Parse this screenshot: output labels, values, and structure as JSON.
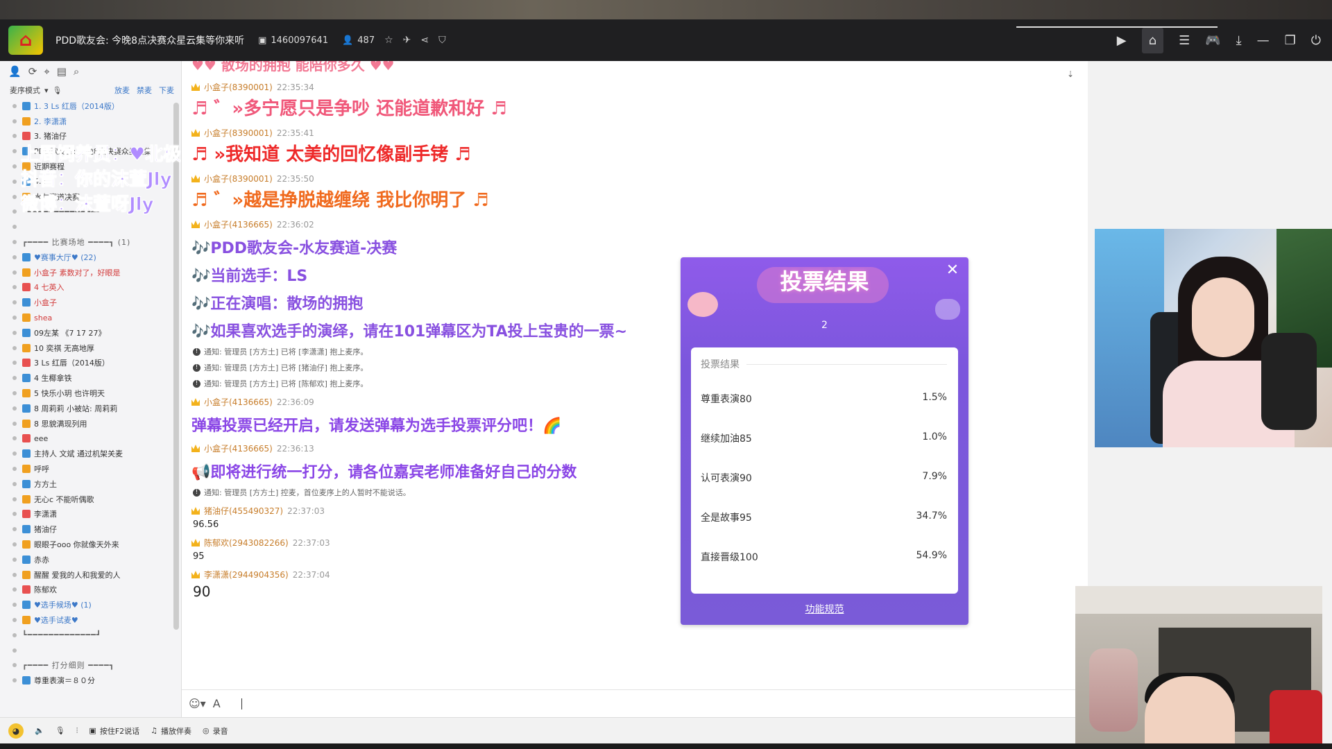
{
  "titlebar": {
    "room_title": "PDD歌友会: 今晚8点决赛众星云集等你来听",
    "room_id": "1460097641",
    "viewers": "487"
  },
  "left": {
    "mode_label": "麦序模式",
    "links": [
      "放麦",
      "禁麦",
      "下麦"
    ],
    "tree": [
      {
        "text": "1.  3 Ls 红唇（2014版）",
        "cls": "blue"
      },
      {
        "text": "2.  李潇潇",
        "cls": "blue"
      },
      {
        "text": "3.  猪油仔",
        "cls": ""
      },
      {
        "text": "PDD歌友会: 今晚8点决赛众星云集",
        "cls": ""
      },
      {
        "text": "近期赛程",
        "cls": ""
      },
      {
        "text": "4.4",
        "cls": ""
      },
      {
        "text": "水友赛道决赛",
        "cls": ""
      },
      {
        "text": "┗━━━━━━━━━━━━━┛",
        "cls": "dash"
      },
      {
        "text": "",
        "cls": ""
      },
      {
        "text": "┏━━━━ 比赛场地 ━━━━┓ (1)",
        "cls": "dash"
      },
      {
        "text": "♥赛事大厅♥ (22)",
        "cls": "blue"
      },
      {
        "text": "小盒子 素数对了，好眼是",
        "cls": "red"
      },
      {
        "text": "4 七英入",
        "cls": "red"
      },
      {
        "text": "小盒子",
        "cls": "red"
      },
      {
        "text": "shea",
        "cls": "red"
      },
      {
        "text": "09左某 《7 17 27》",
        "cls": ""
      },
      {
        "text": "10 奕祺 无高地厚",
        "cls": ""
      },
      {
        "text": "3 Ls 红唇（2014版）",
        "cls": ""
      },
      {
        "text": "4 生椰拿铁",
        "cls": ""
      },
      {
        "text": "5 快乐小玥 也许明天",
        "cls": ""
      },
      {
        "text": "8 周莉莉 小被站: 周莉莉",
        "cls": ""
      },
      {
        "text": "8 思貌满现列用",
        "cls": ""
      },
      {
        "text": "eee",
        "cls": ""
      },
      {
        "text": "主持人 文斌 通过机架关麦",
        "cls": ""
      },
      {
        "text": "呼呼",
        "cls": ""
      },
      {
        "text": "方方土",
        "cls": ""
      },
      {
        "text": "无心c 不能听偶歌",
        "cls": ""
      },
      {
        "text": "李潇潇",
        "cls": ""
      },
      {
        "text": "猪油仔",
        "cls": ""
      },
      {
        "text": "眼眼子ooo 你就像天外来",
        "cls": ""
      },
      {
        "text": "赤赤",
        "cls": ""
      },
      {
        "text": "醒醒 爱我的人和我爱的人",
        "cls": ""
      },
      {
        "text": "陈郁欢",
        "cls": ""
      },
      {
        "text": "♥选手候场♥ (1)",
        "cls": "blue"
      },
      {
        "text": "♥选手试麦♥",
        "cls": "blue"
      },
      {
        "text": "┗━━━━━━━━━━━━━┛",
        "cls": "dash"
      },
      {
        "text": "",
        "cls": ""
      },
      {
        "text": "┏━━━━ 打分细则 ━━━━┓",
        "cls": "dash"
      },
      {
        "text": "尊重表演＝８０分",
        "cls": ""
      }
    ],
    "overlay": [
      "上周饲养员：♥北极星啦啦啦♥",
      "抖音：你的沫萱Jly",
      "微博：沫萱呀Jly"
    ]
  },
  "chat": {
    "top_partial": "♥♥  散场的拥抱  能陪你多久  ♥♥",
    "messages": [
      {
        "type": "head",
        "user": "小盒子(8390001)",
        "time": "22:35:34"
      },
      {
        "type": "big",
        "cls": "pink",
        "text": "♬ ゛»多宁愿只是争吵  还能道歉和好 ♬"
      },
      {
        "type": "head",
        "user": "小盒子(8390001)",
        "time": "22:35:41"
      },
      {
        "type": "big",
        "cls": "red2",
        "text": "♬  »我知道  太美的回忆像副手铐 ♬"
      },
      {
        "type": "head",
        "user": "小盒子(8390001)",
        "time": "22:35:50"
      },
      {
        "type": "big",
        "cls": "orange",
        "text": "♬ ゛»越是挣脱越缠绕  我比你明了 ♬"
      },
      {
        "type": "head",
        "user": "小盒子(4136665)",
        "time": "22:36:02"
      },
      {
        "type": "mid",
        "cls": "purple",
        "text": "🎶PDD歌友会-水友赛道-决赛"
      },
      {
        "type": "mid",
        "cls": "purple",
        "text": "🎶当前选手：LS"
      },
      {
        "type": "mid",
        "cls": "purple",
        "text": "🎶正在演唱：散场的拥抱"
      },
      {
        "type": "mid",
        "cls": "purple",
        "text": "🎶如果喜欢选手的演绎，请在101弹幕区为TA投上宝贵的一票~"
      },
      {
        "type": "notice",
        "text": "通知: 管理员 [方方土] 已将 [李潇潇] 抱上麦序。"
      },
      {
        "type": "notice",
        "text": "通知: 管理员 [方方土] 已将 [猪油仔] 抱上麦序。"
      },
      {
        "type": "notice",
        "text": "通知: 管理员 [方方土] 已将 [陈郁欢] 抱上麦序。"
      },
      {
        "type": "head",
        "user": "小盒子(4136665)",
        "time": "22:36:09"
      },
      {
        "type": "mid",
        "cls": "purple2",
        "text": "弹幕投票已经开启，请发送弹幕为选手投票评分吧！🌈"
      },
      {
        "type": "head",
        "user": "小盒子(4136665)",
        "time": "22:36:13"
      },
      {
        "type": "mid",
        "cls": "purple2",
        "text": "📢即将进行统一打分，请各位嘉宾老师准备好自己的分数"
      },
      {
        "type": "notice",
        "text": "通知: 管理员 [方方土] 控麦，首位麦序上的人暂时不能说话。"
      },
      {
        "type": "head",
        "user": "猪油仔(455490327)",
        "time": "22:37:03"
      },
      {
        "type": "plain",
        "text": "96.56"
      },
      {
        "type": "head",
        "user": "陈郁欢(2943082266)",
        "time": "22:37:03"
      },
      {
        "type": "plain",
        "text": "95"
      },
      {
        "type": "head",
        "user": "李潇潇(2944904356)",
        "time": "22:37:04"
      },
      {
        "type": "plainbig",
        "text": "90"
      }
    ]
  },
  "bottom": {
    "btn_f2": "按住F2说话",
    "btn_accompany": "播放伴奏",
    "btn_record": "录音"
  },
  "vote": {
    "title": "投票结果",
    "round": "2",
    "section": "投票结果",
    "options": [
      {
        "label": "尊重表演80",
        "pct": "1.5%"
      },
      {
        "label": "继续加油85",
        "pct": "1.0%"
      },
      {
        "label": "认可表演90",
        "pct": "7.9%"
      },
      {
        "label": "全是故事95",
        "pct": "34.7%"
      },
      {
        "label": "直接晋级100",
        "pct": "54.9%"
      }
    ],
    "footer": "功能规范"
  }
}
